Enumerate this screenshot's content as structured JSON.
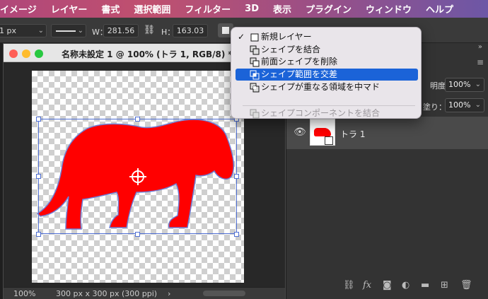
{
  "menu_bar": {
    "items": [
      "イメージ",
      "レイヤー",
      "書式",
      "選択範囲",
      "フィルター",
      "3D",
      "表示",
      "プラグイン",
      "ウィンドウ",
      "ヘルプ"
    ]
  },
  "options_bar": {
    "stroke_width": "1 px",
    "width_label": "W：",
    "width_value": "281.56",
    "height_label": "H：",
    "height_value": "163.03"
  },
  "document": {
    "title": "名称未設定 1 @ 100% (トラ 1, RGB/8) *",
    "zoom": "100%",
    "doc_info": "300 px x 300 px (300 ppi)",
    "fill_color": "#ff0000"
  },
  "path_ops_menu": {
    "items": [
      {
        "label": "新規レイヤー",
        "checked": true,
        "state": "normal"
      },
      {
        "label": "シェイプを結合",
        "checked": false,
        "state": "normal"
      },
      {
        "label": "前面シェイプを削除",
        "checked": false,
        "state": "normal"
      },
      {
        "label": "シェイプ範囲を交差",
        "checked": false,
        "state": "highlighted"
      },
      {
        "label": "シェイプが重なる領域を中マド",
        "checked": false,
        "state": "normal"
      },
      {
        "label": "シェイプコンポーネントを結合",
        "checked": false,
        "state": "disabled"
      }
    ],
    "check_mark": "✓",
    "highlight_color": "#1b63d8"
  },
  "layers_panel": {
    "opacity_label": "明度：",
    "opacity_value": "100%",
    "fill_label": "塗り：",
    "fill_value": "100%",
    "layer_name": "トラ 1",
    "bottom_icons": [
      "link-icon",
      "fx-icon",
      "mask-icon",
      "adjustment-icon",
      "folder-icon",
      "new-layer-icon",
      "trash-icon"
    ],
    "fx_text": "fx"
  }
}
